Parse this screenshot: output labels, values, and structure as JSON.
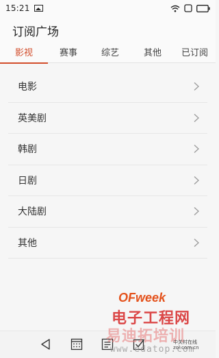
{
  "status_bar": {
    "time": "15:21",
    "icons": [
      "image-icon",
      "wifi-icon",
      "portrait-icon",
      "battery-icon"
    ]
  },
  "header": {
    "title": "订阅广场"
  },
  "tabs": [
    {
      "label": "影视",
      "active": true
    },
    {
      "label": "赛事",
      "active": false
    },
    {
      "label": "综艺",
      "active": false
    },
    {
      "label": "其他",
      "active": false
    },
    {
      "label": "已订阅",
      "active": false
    }
  ],
  "list": {
    "items": [
      {
        "label": "电影"
      },
      {
        "label": "英美剧"
      },
      {
        "label": "韩剧"
      },
      {
        "label": "日剧"
      },
      {
        "label": "大陆剧"
      },
      {
        "label": "其他"
      }
    ]
  },
  "nav_bar": {
    "buttons": [
      "back-icon",
      "calendar-icon",
      "notes-icon",
      "checkbox-icon"
    ]
  },
  "watermark": {
    "brand": "OFweek",
    "title": "电子工程网",
    "subtitle": "易迪拓培训",
    "url": "www.edatop.com",
    "corner_text_1": "中关村在线",
    "corner_text_2": "zol.com.cn"
  },
  "colors": {
    "accent": "#d24c2a"
  }
}
